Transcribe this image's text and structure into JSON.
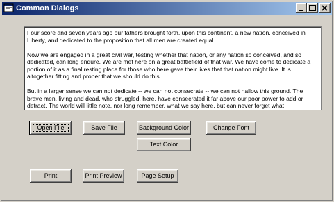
{
  "window": {
    "title": "Common Dialogs",
    "icon": "app-window-icon"
  },
  "titlebar_buttons": {
    "minimize_icon": "minimize-icon",
    "maximize_icon": "maximize-icon",
    "close_icon": "close-icon"
  },
  "document": {
    "paragraphs": [
      "Four score and seven years ago our fathers brought forth, upon this continent, a new nation, conceived in Liberty, and dedicated to the proposition that all men are created equal.",
      "Now we are engaged in a great civil war, testing whether that nation, or any nation so conceived, and so dedicated, can long endure. We are met here on a great battlefield of that war. We have come to dedicate a portion of it as a final resting place for those who here gave their lives that that nation might live. It is altogether fitting and proper that we should do this.",
      "But in a larger sense we can not dedicate -- we can not consecrate -- we can not hallow this ground. The brave men, living and dead, who struggled, here, have consecrated it far above our poor power to add or detract. The world will little note, nor long remember, what we say here, but can never forget what"
    ]
  },
  "buttons": {
    "open_file": "Open File",
    "save_file": "Save File",
    "background_color": "Background Color",
    "change_font": "Change Font",
    "text_color": "Text Color",
    "print": "Print",
    "print_preview": "Print Preview",
    "page_setup": "Page Setup"
  }
}
